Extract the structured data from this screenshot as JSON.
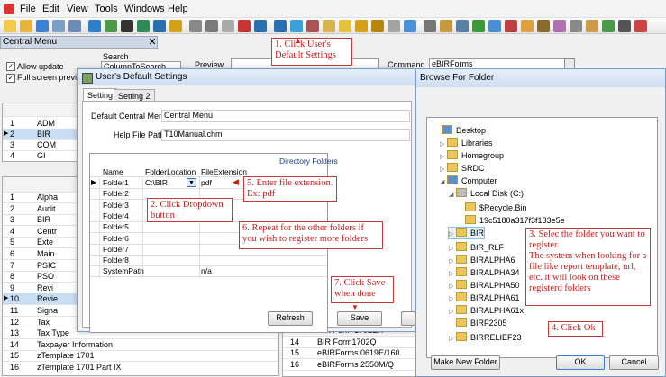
{
  "menubar": {
    "items": [
      "File",
      "Edit",
      "View",
      "Tools",
      "Windows",
      "Help"
    ]
  },
  "toolbar": {
    "icons": [
      "new-icon",
      "open-icon",
      "save-icon",
      "print-icon",
      "preview-icon",
      "upload-icon",
      "report-icon",
      "run-icon",
      "refresh-icon",
      "undo-icon",
      "tools-icon",
      "cut-icon",
      "copy-icon",
      "paste-icon",
      "delete-icon",
      "help-icon",
      "info-icon",
      "calendar-icon",
      "module-icon",
      "user-settings-icon",
      "star-icon",
      "folder-icon",
      "g-icon",
      "pin-icon",
      "monitor-icon",
      "gear-icon",
      "export-icon",
      "calculator-icon",
      "check-icon",
      "grid-icon",
      "chart-icon",
      "table-icon",
      "key-icon",
      "brush-icon",
      "settings-icon",
      "tag-icon",
      "sync-icon",
      "camera-icon",
      "close-icon"
    ]
  },
  "central_menu": {
    "title": "Central Menu"
  },
  "controls": {
    "allow_update": "Allow update",
    "full_screen": "Full screen preview",
    "search_label": "Search",
    "search_value": "ColumnToSearch",
    "preview_label": "Preview",
    "command_label": "Command",
    "command_value": "eBIRForms"
  },
  "left_top_rows": [
    {
      "n": "1",
      "t": "ADM"
    },
    {
      "n": "2",
      "t": "BIR"
    },
    {
      "n": "3",
      "t": "COM"
    },
    {
      "n": "4",
      "t": "GI"
    }
  ],
  "left_bottom_rows": [
    {
      "n": "1",
      "t": "Alpha"
    },
    {
      "n": "2",
      "t": "Audit"
    },
    {
      "n": "3",
      "t": "BIR"
    },
    {
      "n": "4",
      "t": "Centr"
    },
    {
      "n": "5",
      "t": "Exte"
    },
    {
      "n": "6",
      "t": "Main"
    },
    {
      "n": "7",
      "t": "PSIC"
    },
    {
      "n": "8",
      "t": "PSO"
    },
    {
      "n": "9",
      "t": "Revi"
    },
    {
      "n": "10",
      "t": "Revie"
    },
    {
      "n": "11",
      "t": "Signa"
    },
    {
      "n": "12",
      "t": "Tax"
    },
    {
      "n": "13",
      "t": "Tax Type"
    },
    {
      "n": "14",
      "t": "Taxpayer Information"
    },
    {
      "n": "15",
      "t": "zTemplate 1701"
    },
    {
      "n": "16",
      "t": "zTemplate 1701 Part IX"
    }
  ],
  "right_bottom_rows": [
    {
      "n": "13",
      "t": "BIR Form 1702EX"
    },
    {
      "n": "14",
      "t": "BIR Form1702Q"
    },
    {
      "n": "15",
      "t": "eBIRForms 0619E/160"
    },
    {
      "n": "16",
      "t": "eBIRForms 2550M/Q"
    }
  ],
  "dialog": {
    "title": "User's Default Settings",
    "tab_setting": "Setting",
    "tab_setting2": "Setting 2",
    "default_central_menu_label": "Default Central Menu",
    "default_central_menu_value": "Central Menu",
    "help_file_label": "Help File Path",
    "help_file_value": "T10Manual.chm",
    "grid_title": "Directory Folders",
    "col_name": "Name",
    "col_location": "FolderLocation",
    "col_extension": "FileExtension",
    "rows": [
      {
        "name": "Folder1",
        "location": "C:\\BIR",
        "ext": "pdf"
      },
      {
        "name": "Folder2",
        "location": "",
        "ext": ""
      },
      {
        "name": "Folder3",
        "location": "",
        "ext": ""
      },
      {
        "name": "Folder4",
        "location": "",
        "ext": ""
      },
      {
        "name": "Folder5",
        "location": "",
        "ext": ""
      },
      {
        "name": "Folder6",
        "location": "",
        "ext": ""
      },
      {
        "name": "Folder7",
        "location": "",
        "ext": ""
      },
      {
        "name": "Folder8",
        "location": "",
        "ext": ""
      },
      {
        "name": "SystemPath",
        "location": "",
        "ext": "n/a"
      }
    ],
    "refresh": "Refresh",
    "save": "Save"
  },
  "browse": {
    "title": "Browse For Folder",
    "tree": [
      {
        "label": "Desktop",
        "expander": "",
        "icon": "desktop-icon"
      },
      {
        "label": "Libraries",
        "expander": "▷",
        "icon": "libraries-icon"
      },
      {
        "label": "Homegroup",
        "expander": "▷",
        "icon": "homegroup-icon"
      },
      {
        "label": "SRDC",
        "expander": "▷",
        "icon": "user-folder-icon"
      },
      {
        "label": "Computer",
        "expander": "◢",
        "icon": "computer-icon"
      },
      {
        "label": "Local Disk (C:)",
        "expander": "◢",
        "icon": "disk-icon"
      },
      {
        "label": "$Recycle.Bin",
        "expander": "",
        "icon": "folder-icon"
      },
      {
        "label": "19c5180a317f3f133e5e",
        "expander": "",
        "icon": "folder-icon"
      },
      {
        "label": "BIR",
        "expander": "▷",
        "icon": "folder-icon"
      },
      {
        "label": "BIR_RLF",
        "expander": "▷",
        "icon": "folder-icon"
      },
      {
        "label": "BIRALPHA6",
        "expander": "▷",
        "icon": "folder-icon"
      },
      {
        "label": "BIRALPHA34",
        "expander": "▷",
        "icon": "folder-icon"
      },
      {
        "label": "BIRALPHA50",
        "expander": "▷",
        "icon": "folder-icon"
      },
      {
        "label": "BIRALPHA61",
        "expander": "▷",
        "icon": "folder-icon"
      },
      {
        "label": "BIRALPHA61x",
        "expander": "▷",
        "icon": "folder-icon"
      },
      {
        "label": "BIRF2305",
        "expander": "",
        "icon": "folder-icon"
      },
      {
        "label": "BIRRELIEF23",
        "expander": "▷",
        "icon": "folder-icon"
      }
    ],
    "new_folder": "Make New Folder",
    "ok": "OK",
    "cancel": "Cancel"
  },
  "callouts": {
    "c1": "1. Click User's Default Settings",
    "c2": "2. Click Dropdown button",
    "c3": "3. Selec the folder you want to register.\nThe system when looking for a file like report template, url, etc. it will look on these registerd folders",
    "c4": "4. Click Ok",
    "c5": "5. Enter file extension.\nEx: pdf",
    "c6": "6. Repeat for the other folders if you wish to register more folders",
    "c7": "7. Click Save when done"
  },
  "colors": {
    "callout_text": "#c41f1f",
    "callout_border": "#c03a3a",
    "title_bar": "#cfddf2"
  }
}
